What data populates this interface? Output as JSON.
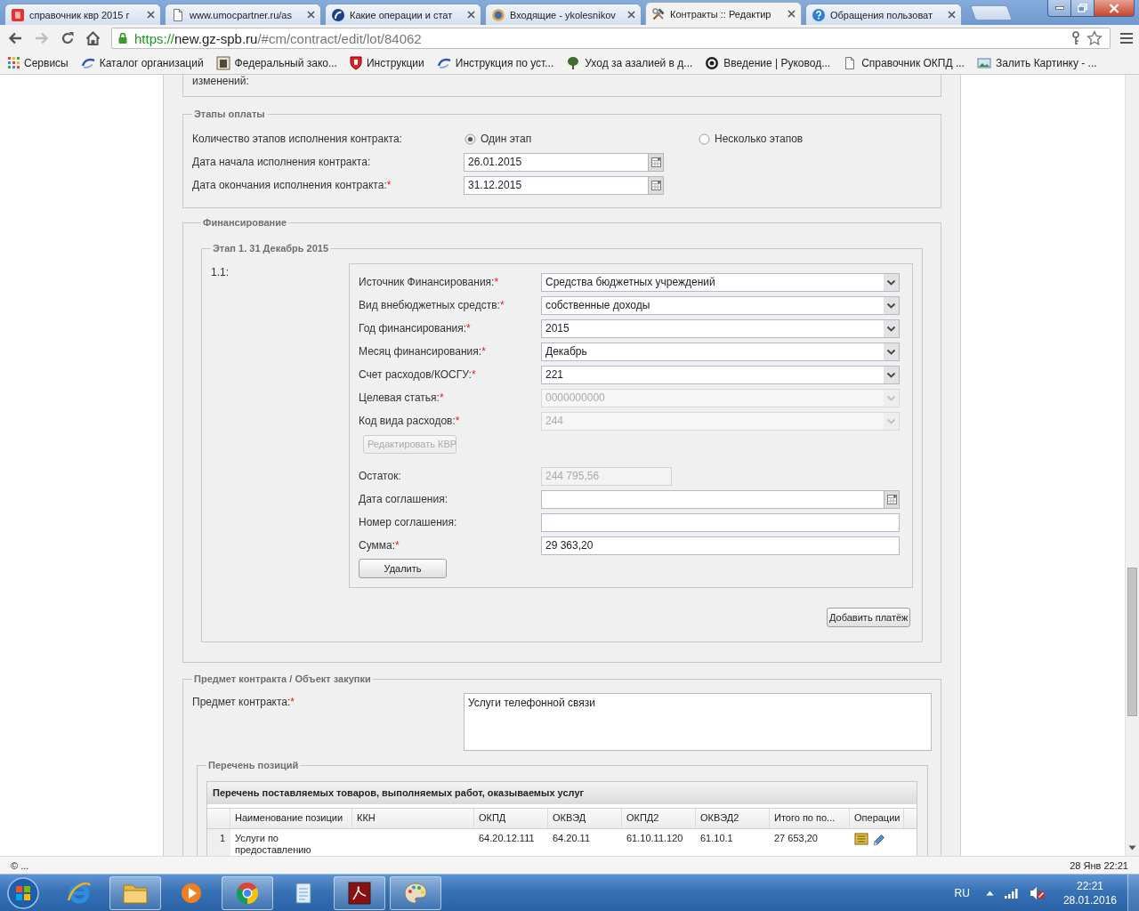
{
  "browser": {
    "tabs": [
      {
        "title": "справочник квр 2015 г",
        "selected": false
      },
      {
        "title": "www.umocpartner.ru/as",
        "selected": false
      },
      {
        "title": "Какие операции и стат",
        "selected": false
      },
      {
        "title": "Входящие - ykolesnikov",
        "selected": false
      },
      {
        "title": "Контракты :: Редактир",
        "selected": true
      },
      {
        "title": "Обращения пользоват",
        "selected": false
      }
    ],
    "address": {
      "scheme": "https://",
      "host": "new.gz-spb.ru",
      "path": "/#cm/contract/edit/lot/84062"
    },
    "bookmarks": [
      {
        "label": "Сервисы"
      },
      {
        "label": "Каталог организаций"
      },
      {
        "label": "Федеральный зако..."
      },
      {
        "label": "Инструкции"
      },
      {
        "label": "Инструкция по уст..."
      },
      {
        "label": "Уход за азалией в д..."
      },
      {
        "label": "Введение | Руковод..."
      },
      {
        "label": "Справочник ОКПД ..."
      },
      {
        "label": "Залить Картинку - ..."
      }
    ]
  },
  "page": {
    "top_note": "изменений:",
    "payment_stages": {
      "legend": "Этапы оплаты",
      "count_label": "Количество этапов исполнения контракта:",
      "options": [
        {
          "label": "Один этап",
          "selected": true
        },
        {
          "label": "Несколько этапов",
          "selected": false
        }
      ],
      "dates": [
        {
          "label": "Дата начала исполнения контракта:",
          "value": "26.01.2015"
        },
        {
          "label": "Дата окончания исполнения контракта:",
          "required_mark": "*",
          "value": "31.12.2015"
        }
      ]
    },
    "financing": {
      "legend": "Финансирование",
      "stage": {
        "legend": "Этап 1. 31 Декабрь 2015",
        "number": "1.1:",
        "selects": [
          {
            "label": "Источник Финансирования:",
            "required_mark": "*",
            "value": "Средства бюджетных учреждений",
            "disabled": false
          },
          {
            "label": "Вид внебюджетных средств:",
            "required_mark": "*",
            "value": "собственные доходы",
            "disabled": false
          },
          {
            "label": "Год финансирования:",
            "required_mark": "*",
            "value": "2015",
            "disabled": false
          },
          {
            "label": "Месяц финансирования:",
            "required_mark": "*",
            "value": "Декабрь",
            "disabled": false
          },
          {
            "label": "Счет расходов/КОСГУ:",
            "required_mark": "*",
            "value": "221",
            "disabled": false
          },
          {
            "label": "Целевая статья:",
            "required_mark": "*",
            "value": "0000000000",
            "disabled": true
          },
          {
            "label": "Код вида расходов:",
            "required_mark": "*",
            "value": "244",
            "disabled": true
          }
        ],
        "edit_button": {
          "label": "Редактировать КВР",
          "disabled": true
        },
        "fields": [
          {
            "label": "Остаток:",
            "kind": "text",
            "value": "244 795,56",
            "disabled": true
          },
          {
            "label": "Дата соглашения:",
            "kind": "date",
            "disabled": false
          },
          {
            "label": "Номер соглашения:",
            "kind": "text",
            "disabled": false
          },
          {
            "label": "Сумма:",
            "required_mark": "*",
            "kind": "text",
            "value": "29 363,20",
            "disabled": false
          }
        ],
        "delete_button": "Удалить"
      },
      "add_button": "Добавить платёж"
    },
    "subject": {
      "legend": "Предмет контракта / Объект закупки",
      "label": "Предмет контракта:",
      "required_mark": "*",
      "value": "Услуги телефонной связи",
      "positions": {
        "legend": "Перечень позиций",
        "title": "Перечень поставляемых товаров, выполняемых работ, оказываемых услуг",
        "columns": [
          "Наименование позиции",
          "ККН",
          "ОКПД",
          "ОКВЭД",
          "ОКПД2",
          "ОКВЭД2",
          "Итого по по...",
          "Операции"
        ],
        "rows": [
          {
            "number": "1",
            "cells": [
              "Услуги по предоставлению",
              null,
              "64.20.12.111",
              "64.20.11",
              "61.10.11.120",
              "61.10.1",
              "27 653,20"
            ]
          }
        ]
      }
    }
  },
  "status_bar": {
    "left": "© ...",
    "right": "28 Янв 22:21"
  },
  "taskbar": {
    "apps": [
      {
        "running": false
      },
      {
        "running": true
      },
      {
        "running": false
      },
      {
        "running": true
      },
      {
        "running": false
      },
      {
        "running": true
      },
      {
        "running": true
      }
    ],
    "language": "RU",
    "time": "22:21",
    "date": "28.01.2016"
  }
}
